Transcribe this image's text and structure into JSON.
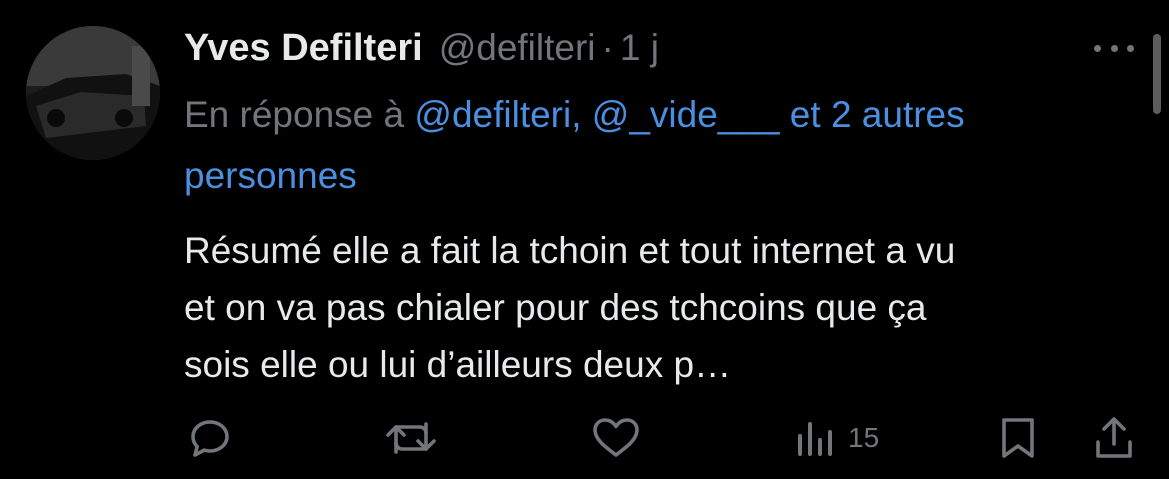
{
  "tweet": {
    "display_name": "Yves Defilteri",
    "handle": "@defilteri",
    "separator": "·",
    "time": "1 j",
    "reply_prefix": "En réponse à ",
    "reply_mentions": "@defilteri, @_vide___ et 2 autres personnes",
    "text": "Résumé elle a fait la tchoin et tout internet a vu\net on va pas chialer pour des tchcoins que ça\nsois elle ou lui d’ailleurs deux p…",
    "views": "15"
  },
  "icons": {
    "reply": "reply-icon",
    "retweet": "retweet-icon",
    "like": "heart-icon",
    "views": "views-icon",
    "bookmark": "bookmark-icon",
    "share": "share-icon",
    "more": "more-icon"
  },
  "colors": {
    "background": "#000000",
    "text": "#e7e9ea",
    "muted": "#71767b",
    "link": "#4a8fe0"
  }
}
